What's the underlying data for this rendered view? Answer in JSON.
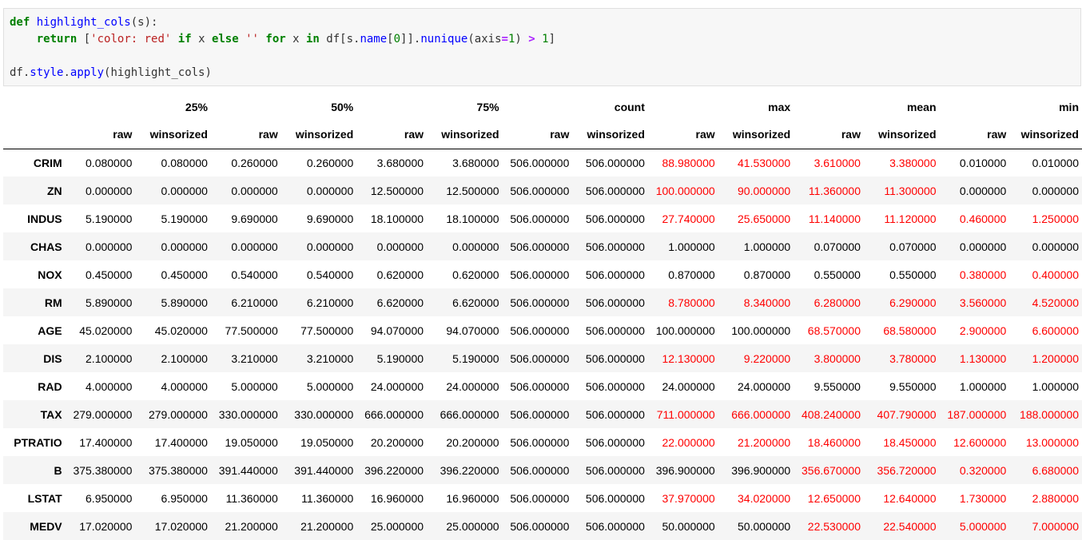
{
  "code": {
    "line1": {
      "kw_def": "def",
      "fn_name": "highlight_cols",
      "args": "(s):"
    },
    "line2": {
      "kw_return": "return",
      "open": "[",
      "str_red": "'color: red'",
      "kw_if": "if",
      "x1": "x",
      "kw_else": "else",
      "str_empty": "''",
      "kw_for": "for",
      "x2": "x",
      "kw_in": "in",
      "df_part": "df[s.",
      "name_attr": "name",
      "idx": "[",
      "zero": "0",
      "close_idx": "]].",
      "nunique": "nunique",
      "args": "(axis",
      "eq": "=",
      "one_a": "1",
      "paren": ")",
      "gt": ">",
      "one_b": "1",
      "close": "]"
    },
    "line4": {
      "df": "df.",
      "style": "style",
      "dot": ".",
      "apply": "apply",
      "args": "(highlight_cols)"
    }
  },
  "table": {
    "top_headers": [
      "25%",
      "50%",
      "75%",
      "count",
      "max",
      "mean",
      "min"
    ],
    "sub_headers": [
      "raw",
      "winsorized",
      "raw",
      "winsorized",
      "raw",
      "winsorized",
      "raw",
      "winsorized",
      "raw",
      "winsorized",
      "raw",
      "winsorized",
      "raw",
      "winsorized"
    ],
    "highlight_color": "#ff0000",
    "rows": [
      {
        "label": "CRIM",
        "values": [
          "0.080000",
          "0.080000",
          "0.260000",
          "0.260000",
          "3.680000",
          "3.680000",
          "506.000000",
          "506.000000",
          "88.980000",
          "41.530000",
          "3.610000",
          "3.380000",
          "0.010000",
          "0.010000"
        ]
      },
      {
        "label": "ZN",
        "values": [
          "0.000000",
          "0.000000",
          "0.000000",
          "0.000000",
          "12.500000",
          "12.500000",
          "506.000000",
          "506.000000",
          "100.000000",
          "90.000000",
          "11.360000",
          "11.300000",
          "0.000000",
          "0.000000"
        ]
      },
      {
        "label": "INDUS",
        "values": [
          "5.190000",
          "5.190000",
          "9.690000",
          "9.690000",
          "18.100000",
          "18.100000",
          "506.000000",
          "506.000000",
          "27.740000",
          "25.650000",
          "11.140000",
          "11.120000",
          "0.460000",
          "1.250000"
        ]
      },
      {
        "label": "CHAS",
        "values": [
          "0.000000",
          "0.000000",
          "0.000000",
          "0.000000",
          "0.000000",
          "0.000000",
          "506.000000",
          "506.000000",
          "1.000000",
          "1.000000",
          "0.070000",
          "0.070000",
          "0.000000",
          "0.000000"
        ]
      },
      {
        "label": "NOX",
        "values": [
          "0.450000",
          "0.450000",
          "0.540000",
          "0.540000",
          "0.620000",
          "0.620000",
          "506.000000",
          "506.000000",
          "0.870000",
          "0.870000",
          "0.550000",
          "0.550000",
          "0.380000",
          "0.400000"
        ]
      },
      {
        "label": "RM",
        "values": [
          "5.890000",
          "5.890000",
          "6.210000",
          "6.210000",
          "6.620000",
          "6.620000",
          "506.000000",
          "506.000000",
          "8.780000",
          "8.340000",
          "6.280000",
          "6.290000",
          "3.560000",
          "4.520000"
        ]
      },
      {
        "label": "AGE",
        "values": [
          "45.020000",
          "45.020000",
          "77.500000",
          "77.500000",
          "94.070000",
          "94.070000",
          "506.000000",
          "506.000000",
          "100.000000",
          "100.000000",
          "68.570000",
          "68.580000",
          "2.900000",
          "6.600000"
        ]
      },
      {
        "label": "DIS",
        "values": [
          "2.100000",
          "2.100000",
          "3.210000",
          "3.210000",
          "5.190000",
          "5.190000",
          "506.000000",
          "506.000000",
          "12.130000",
          "9.220000",
          "3.800000",
          "3.780000",
          "1.130000",
          "1.200000"
        ]
      },
      {
        "label": "RAD",
        "values": [
          "4.000000",
          "4.000000",
          "5.000000",
          "5.000000",
          "24.000000",
          "24.000000",
          "506.000000",
          "506.000000",
          "24.000000",
          "24.000000",
          "9.550000",
          "9.550000",
          "1.000000",
          "1.000000"
        ]
      },
      {
        "label": "TAX",
        "values": [
          "279.000000",
          "279.000000",
          "330.000000",
          "330.000000",
          "666.000000",
          "666.000000",
          "506.000000",
          "506.000000",
          "711.000000",
          "666.000000",
          "408.240000",
          "407.790000",
          "187.000000",
          "188.000000"
        ]
      },
      {
        "label": "PTRATIO",
        "values": [
          "17.400000",
          "17.400000",
          "19.050000",
          "19.050000",
          "20.200000",
          "20.200000",
          "506.000000",
          "506.000000",
          "22.000000",
          "21.200000",
          "18.460000",
          "18.450000",
          "12.600000",
          "13.000000"
        ]
      },
      {
        "label": "B",
        "values": [
          "375.380000",
          "375.380000",
          "391.440000",
          "391.440000",
          "396.220000",
          "396.220000",
          "506.000000",
          "506.000000",
          "396.900000",
          "396.900000",
          "356.670000",
          "356.720000",
          "0.320000",
          "6.680000"
        ]
      },
      {
        "label": "LSTAT",
        "values": [
          "6.950000",
          "6.950000",
          "11.360000",
          "11.360000",
          "16.960000",
          "16.960000",
          "506.000000",
          "506.000000",
          "37.970000",
          "34.020000",
          "12.650000",
          "12.640000",
          "1.730000",
          "2.880000"
        ]
      },
      {
        "label": "MEDV",
        "values": [
          "17.020000",
          "17.020000",
          "21.200000",
          "21.200000",
          "25.000000",
          "25.000000",
          "506.000000",
          "506.000000",
          "50.000000",
          "50.000000",
          "22.530000",
          "22.540000",
          "5.000000",
          "7.000000"
        ]
      }
    ]
  }
}
